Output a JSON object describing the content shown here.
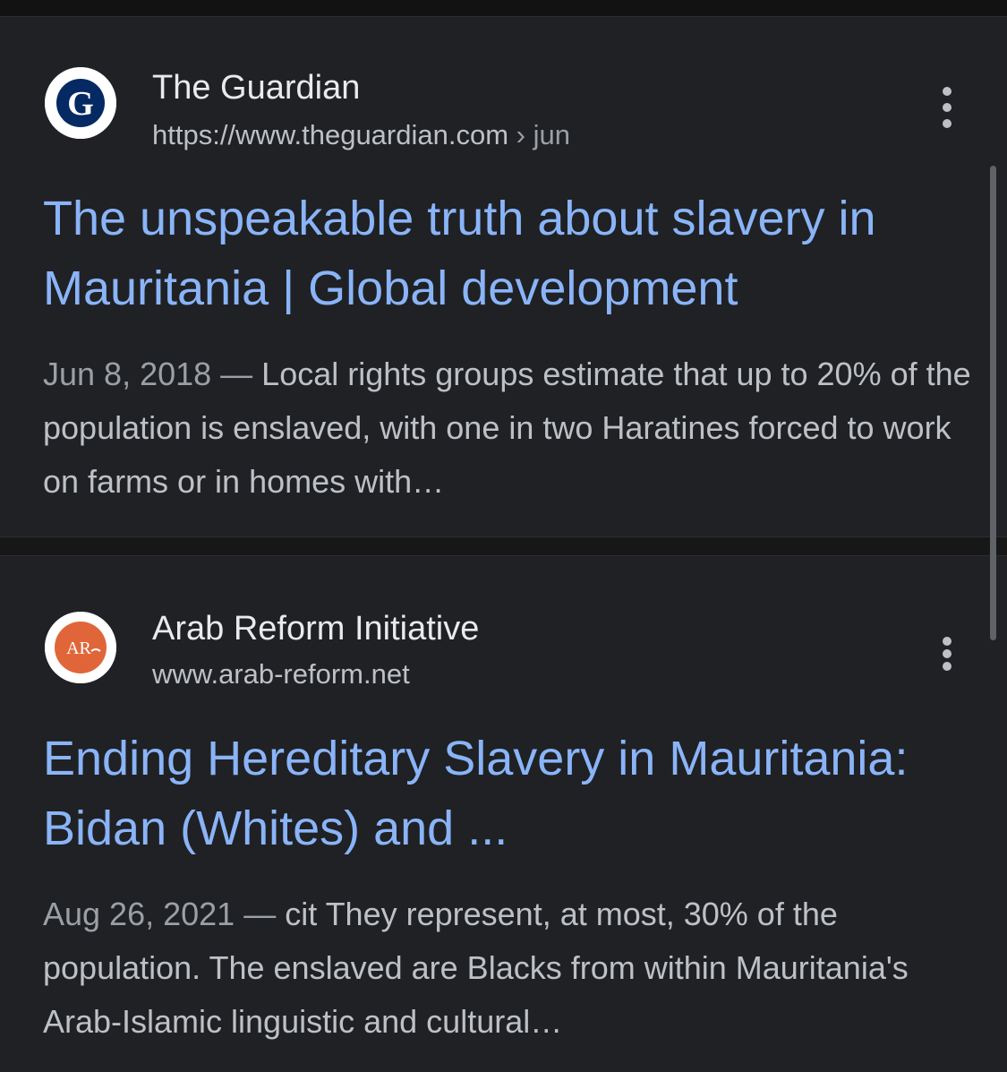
{
  "results": [
    {
      "site_name": "The Guardian",
      "url": "https://www.theguardian.com",
      "breadcrumb": "› jun",
      "favicon_icon": "guardian-g-logo",
      "favicon_letter": "G",
      "title": "The unspeakable truth about slavery in Mauritania | Global development",
      "date": "Jun 8, 2018",
      "snippet": "Local rights groups estimate that up to 20% of the population is enslaved, with one in two Haratines forced to work on farms or in homes with…"
    },
    {
      "site_name": "Arab Reform Initiative",
      "url": "www.arab-reform.net",
      "breadcrumb": "",
      "favicon_icon": "arab-reform-logo",
      "favicon_letter": "AR",
      "title": "Ending Hereditary Slavery in Mauritania: Bidan (Whites) and ...",
      "date": "Aug 26, 2021",
      "snippet": "cit They represent, at most, 30% of the population. The enslaved are Blacks from within Mauritania's Arab-Islamic linguistic and cultural…"
    }
  ],
  "date_separator": " — ",
  "more_options_icon": "more-vert-icon",
  "colors": {
    "background": "#171717",
    "card": "#202124",
    "link": "#8ab4f8",
    "text_primary": "#e8eaed",
    "text_secondary": "#bdc1c6",
    "guardian_blue": "#052962",
    "arab_reform_orange": "#e0663a"
  }
}
